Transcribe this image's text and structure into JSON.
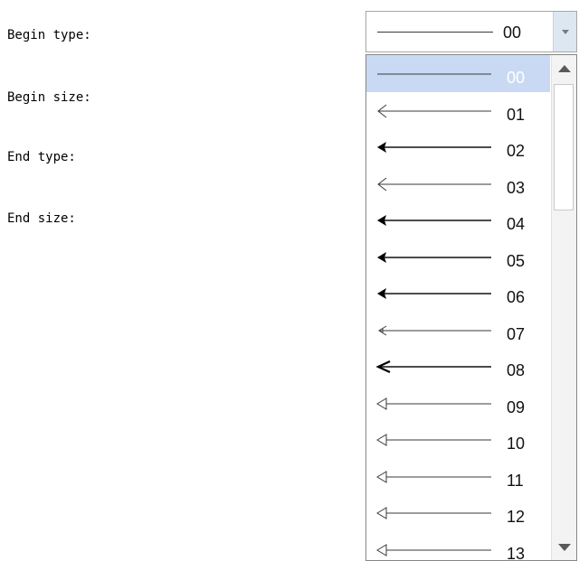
{
  "form": {
    "labels": {
      "begin_type": "Begin type:",
      "begin_size": "Begin size:",
      "end_type": "End type:",
      "end_size": "End size:"
    }
  },
  "combo": {
    "selected_value": "00",
    "selected_icon": "plain-line"
  },
  "dropdown": {
    "selected_index": 0,
    "items": [
      {
        "value": "00",
        "icon": "plain-line"
      },
      {
        "value": "01",
        "icon": "open-thin-arrow"
      },
      {
        "value": "02",
        "icon": "filled-arrow"
      },
      {
        "value": "03",
        "icon": "open-thin-arrow"
      },
      {
        "value": "04",
        "icon": "filled-arrow"
      },
      {
        "value": "05",
        "icon": "filled-arrow"
      },
      {
        "value": "06",
        "icon": "filled-arrow"
      },
      {
        "value": "07",
        "icon": "split-thin-arrow"
      },
      {
        "value": "08",
        "icon": "bold-open-arrow"
      },
      {
        "value": "09",
        "icon": "hollow-triangle-arrow"
      },
      {
        "value": "10",
        "icon": "hollow-triangle-arrow"
      },
      {
        "value": "11",
        "icon": "hollow-triangle-arrow"
      },
      {
        "value": "12",
        "icon": "hollow-triangle-arrow"
      },
      {
        "value": "13",
        "icon": "hollow-triangle-arrow"
      }
    ]
  },
  "colors": {
    "selection_bg": "#cad9f3",
    "line": "#3a3a3a"
  }
}
